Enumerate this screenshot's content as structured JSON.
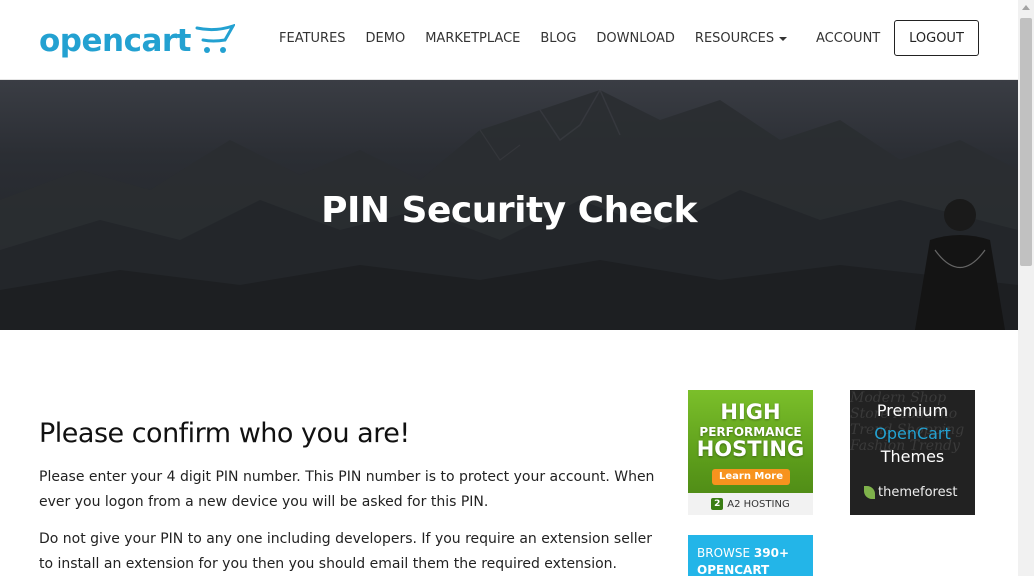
{
  "header": {
    "logo_text": "opencart",
    "nav": [
      {
        "label": "FEATURES"
      },
      {
        "label": "DEMO"
      },
      {
        "label": "MARKETPLACE"
      },
      {
        "label": "BLOG"
      },
      {
        "label": "DOWNLOAD"
      },
      {
        "label": "RESOURCES"
      }
    ],
    "account_label": "ACCOUNT",
    "logout_label": "LOGOUT"
  },
  "hero": {
    "title": "PIN Security Check"
  },
  "main": {
    "heading": "Please confirm who you are!",
    "paragraph_1": "Please enter your 4 digit PIN number. This PIN number is to protect your account. When ever you logon from a new device you will be asked for this PIN.",
    "paragraph_2": "Do not give your PIN to any one including developers. If you require an extension seller to install an extension for you then you should email them the required extension."
  },
  "ads": {
    "a2": {
      "line1": "HIGH",
      "line2": "PERFORMANCE",
      "line3": "HOSTING",
      "button": "Learn More",
      "footer_mark": "2",
      "footer": "A2 HOSTING"
    },
    "themeforest": {
      "bg_text": "Modern Shop Store Moderno Trend Shopping Fashion Trendy",
      "line1": "Premium",
      "line2": "OpenCart",
      "line3": "Themes",
      "brand": "themeforest"
    },
    "opencart": {
      "line1_prefix": "BROWSE ",
      "line1_count": "390+",
      "line2": "OPENCART"
    }
  },
  "colors": {
    "brand": "#23a1d1",
    "a2_green": "#5a9a1a",
    "a2_orange": "#f7931e",
    "opencart_blue": "#23b5e8"
  }
}
